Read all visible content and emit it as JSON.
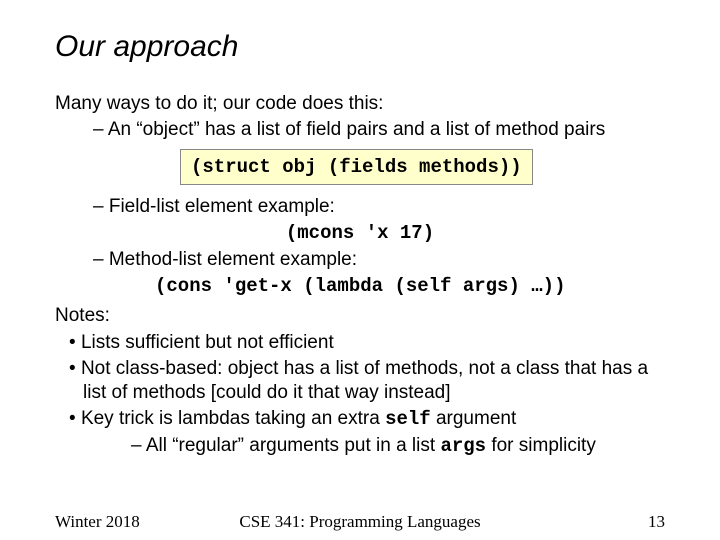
{
  "title": "Our approach",
  "intro": "Many ways to do it;  our code does this:",
  "sub1": "An “object” has a list of field pairs and a list of method pairs",
  "code1": "(struct obj (fields methods))",
  "sub2": "Field-list element example:",
  "code2": "(mcons 'x 17)",
  "sub3": "Method-list element example:",
  "code3": "(cons 'get-x (lambda (self args) …))",
  "notes_label": "Notes:",
  "n1": "Lists sufficient but not efficient",
  "n2": "Not class-based: object has a list of methods, not a class that has a list of methods [could do it that way instead]",
  "n3a": "Key trick is lambdas taking an extra ",
  "n3_self": "self",
  "n3b": " argument",
  "n3sub_a": "All “regular” arguments put in a list ",
  "n3sub_args": "args",
  "n3sub_b": " for simplicity",
  "footer_left": "Winter 2018",
  "footer_center": "CSE 341: Programming Languages",
  "footer_right": "13"
}
